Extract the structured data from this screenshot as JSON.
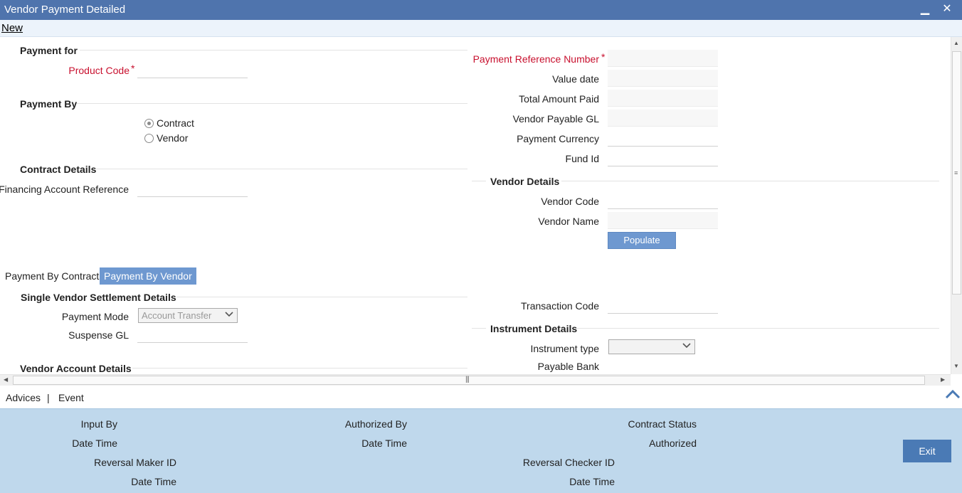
{
  "window": {
    "title": "Vendor Payment Detailed",
    "minimize": "▁",
    "close": "✕"
  },
  "toolbar": {
    "new_label": "New"
  },
  "payment_for": {
    "title": "Payment for",
    "product_code_label": "Product Code",
    "required_mark": "*"
  },
  "right_top": {
    "payment_reference_number_label": "Payment Reference Number",
    "value_date_label": "Value date",
    "total_amount_paid_label": "Total Amount Paid",
    "vendor_payable_gl_label": "Vendor Payable GL",
    "payment_currency_label": "Payment Currency",
    "fund_id_label": "Fund Id"
  },
  "payment_by": {
    "title": "Payment By",
    "options": [
      "Contract",
      "Vendor"
    ],
    "selected": "Contract"
  },
  "contract_details": {
    "title": "Contract Details",
    "financing_account_reference_label": "Financing Account Reference"
  },
  "vendor_details": {
    "title": "Vendor Details",
    "vendor_code_label": "Vendor Code",
    "vendor_name_label": "Vendor Name",
    "populate_label": "Populate"
  },
  "tabs": [
    {
      "label": "Payment By Contract",
      "active": false
    },
    {
      "label": "Payment By Vendor",
      "active": true
    }
  ],
  "settlement": {
    "title": "Single Vendor Settlement Details",
    "payment_mode_label": "Payment Mode",
    "payment_mode_value": "Account Transfer",
    "suspense_gl_label": "Suspense GL",
    "transaction_code_label": "Transaction Code"
  },
  "instrument": {
    "title": "Instrument Details",
    "instrument_type_label": "Instrument type",
    "payable_bank_label": "Payable Bank"
  },
  "vendor_account": {
    "title": "Vendor Account Details"
  },
  "links": {
    "advices": "Advices",
    "separator": "|",
    "event": "Event"
  },
  "footer": {
    "input_by": "Input By",
    "date_time_1": "Date Time",
    "reversal_maker_id": "Reversal Maker ID",
    "date_time_2": "Date Time",
    "authorized_by": "Authorized By",
    "date_time_3": "Date Time",
    "contract_status": "Contract Status",
    "authorized": "Authorized",
    "reversal_checker_id": "Reversal Checker ID",
    "date_time_4": "Date Time",
    "exit_label": "Exit"
  },
  "colors": {
    "titlebar": "#4f74ad",
    "required": "#c8102e",
    "accent_button": "#6e98d0",
    "footer_bg": "#bfd8ec",
    "exit_button": "#4a7ab5"
  }
}
